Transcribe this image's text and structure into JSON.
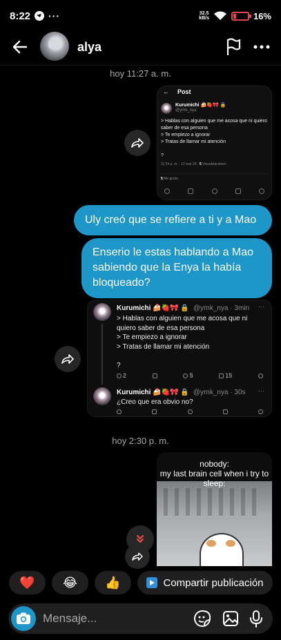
{
  "status_bar": {
    "time": "8:22",
    "net_speed_top": "32.5",
    "net_speed_unit": "kB/s",
    "battery": "16%",
    "notification_dots": "···"
  },
  "header": {
    "contact_name": "alya"
  },
  "messages": {
    "timestamp_1": "hoy 11:27 a. m.",
    "post1": {
      "header": "Post",
      "author": "Kurumichi 🍰🍓🎀 🔒",
      "handle": "@yrnk_nya",
      "body": "> Hablas con alguien que me acosa que ni quiero saber de esa persona\n> Te empiezo a ignorar\n> Tratas de llamar mi atención\n\n?",
      "meta_prefix": "11:24 a. m. · 12 mar 25 · ",
      "views": "5",
      "views_label": " Visualizaciones",
      "likes": "5",
      "likes_label": " Me gusta"
    },
    "bubble_1": "Uly creó que se refiere a ti y a Mao",
    "bubble_2": "Enserio le estas hablando a Mao sabiendo que la Enya la había bloqueado?",
    "post2": {
      "tweet1": {
        "author": "Kurumichi 🍰🍓🎀 🔒",
        "handle_time": "@yrnk_nya · 3min",
        "body": "> Hablas con alguien que me acosa que ni quiero saber de esa persona\n> Te empiezo a ignorar\n> Tratas de llamar mi atención\n\n?",
        "replies": "2",
        "likes": "5",
        "views": "15"
      },
      "tweet2": {
        "author": "Kurumichi 🍰🍓🎀 🔒",
        "handle_time": "@yrnk_nya · 30s",
        "body": "¿Creo que era obvio no?"
      }
    },
    "timestamp_2": "hoy 2:30 p. m.",
    "meme_caption": "nobody:\nmy last brain cell when i try to sleep:"
  },
  "quick_replies": {
    "heart": "❤️",
    "laugh": "😂",
    "thumbs": "👍",
    "share_label": "Compartir publicación"
  },
  "composer": {
    "placeholder": "Mensaje..."
  },
  "colors": {
    "bubble": "#1e96c8",
    "background": "#000000",
    "surface": "#1f1f1f"
  }
}
